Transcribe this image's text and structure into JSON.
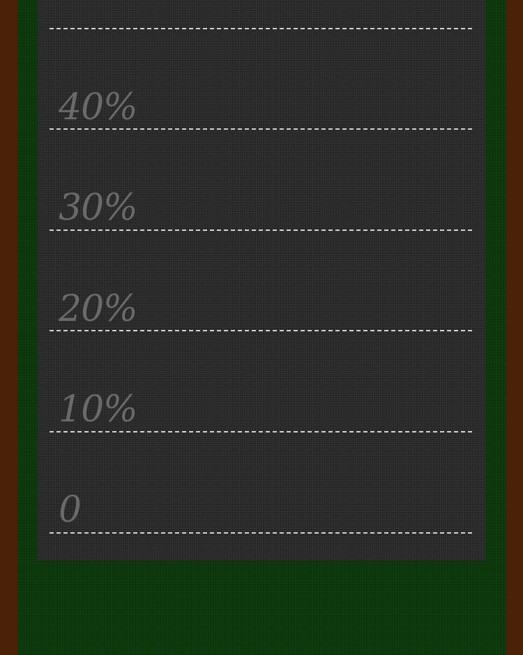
{
  "scale": {
    "labels": [
      "40%",
      "30%",
      "20%",
      "10%",
      "0"
    ]
  },
  "colors": {
    "outer_border": "#4a2207",
    "felt": "#0d3a0d",
    "board": "#2a2a2a",
    "gridline": "#e6e6e6",
    "label": "#6a6a6a"
  }
}
